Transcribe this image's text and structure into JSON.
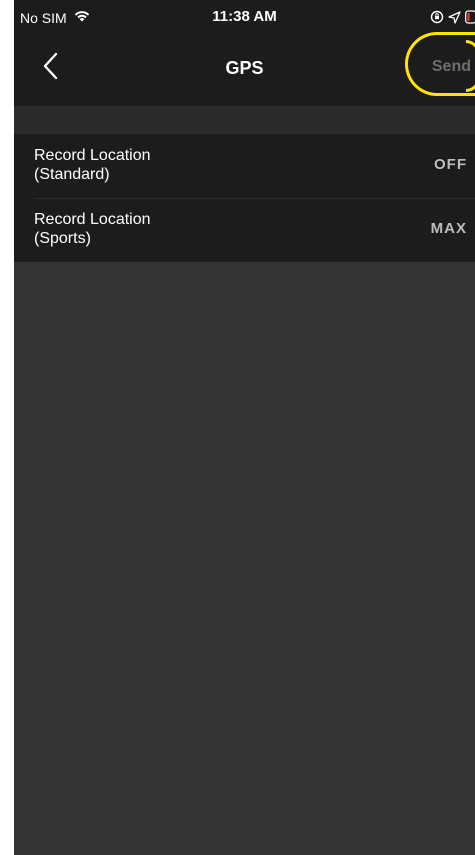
{
  "status_bar": {
    "carrier": "No SIM",
    "time": "11:38 AM",
    "icons": [
      "wifi-icon",
      "orientation-lock-icon",
      "location-arrow-icon",
      "battery-icon"
    ]
  },
  "nav": {
    "back_icon": "chevron-left-icon",
    "title": "GPS",
    "send_label": "Send"
  },
  "settings": [
    {
      "label_line1": "Record Location",
      "label_line2": "(Standard)",
      "value": "OFF"
    },
    {
      "label_line1": "Record Location",
      "label_line2": "(Sports)",
      "value": "MAX"
    }
  ],
  "colors": {
    "background": "#343434",
    "bar": "#1c1c1c",
    "highlight": "#ffe400",
    "battery_low": "#ff3b30"
  }
}
